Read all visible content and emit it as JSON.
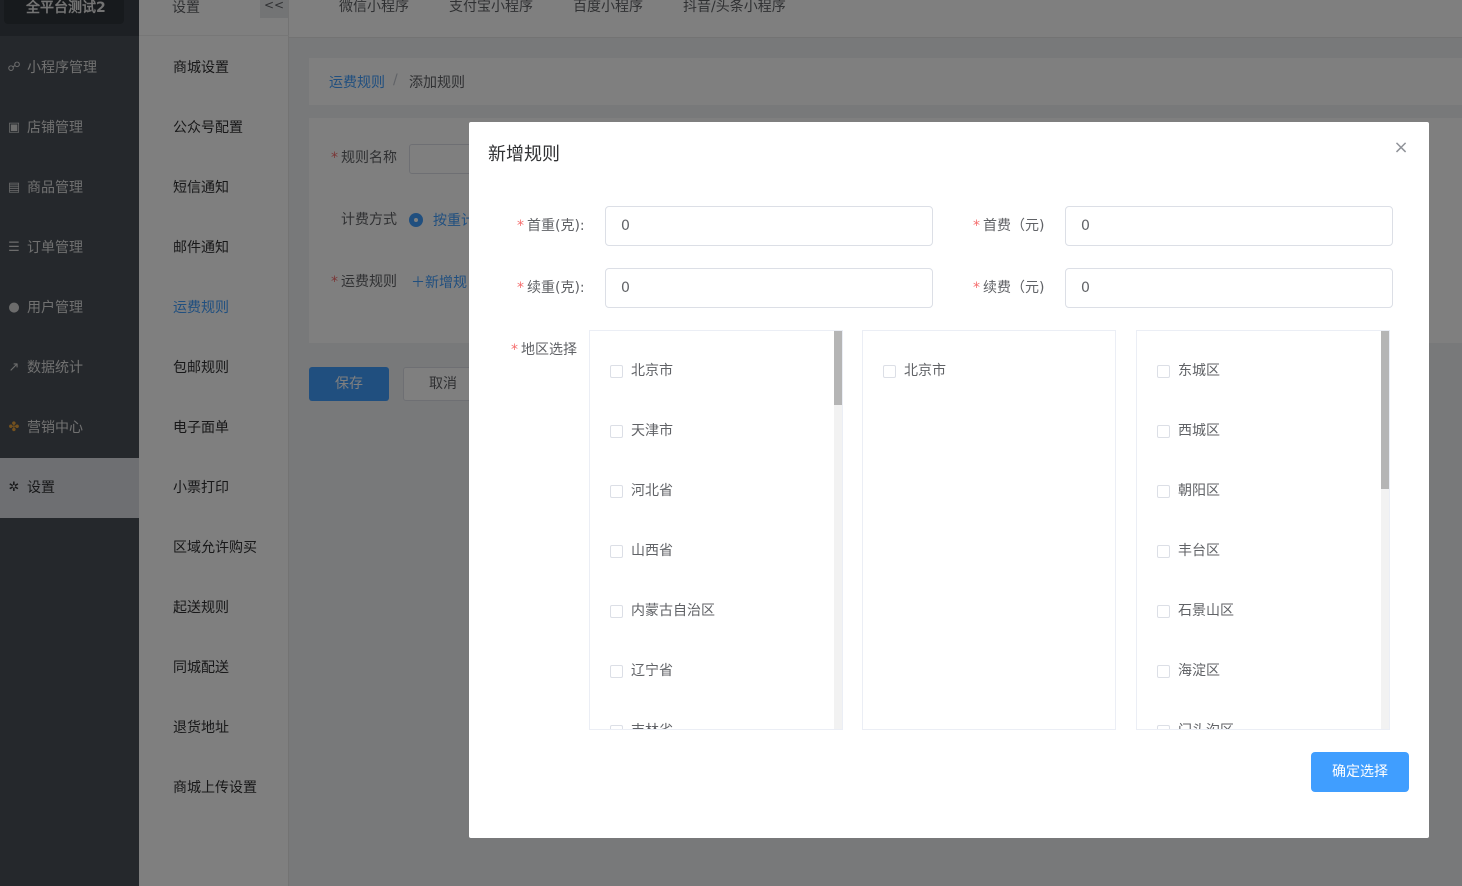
{
  "nav": {
    "brand": "全平台测试2",
    "items": [
      {
        "label": "小程序管理",
        "icon": "link-icon",
        "glyph": "☍"
      },
      {
        "label": "店铺管理",
        "icon": "store-icon",
        "glyph": "▣"
      },
      {
        "label": "商品管理",
        "icon": "goods-icon",
        "glyph": "▤"
      },
      {
        "label": "订单管理",
        "icon": "order-icon",
        "glyph": "☰"
      },
      {
        "label": "用户管理",
        "icon": "user-icon",
        "glyph": "●"
      },
      {
        "label": "数据统计",
        "icon": "chart-icon",
        "glyph": "↗"
      },
      {
        "label": "营销中心",
        "icon": "marketing-icon",
        "glyph": "✤"
      },
      {
        "label": "设置",
        "icon": "gear-icon",
        "glyph": "✲"
      }
    ]
  },
  "submenu": {
    "title": "设置",
    "collapse": "<<",
    "items": [
      "商城设置",
      "公众号配置",
      "短信通知",
      "邮件通知",
      "运费规则",
      "包邮规则",
      "电子面单",
      "小票打印",
      "区域允许购买",
      "起送规则",
      "同城配送",
      "退货地址",
      "商城上传设置"
    ],
    "active": "运费规则"
  },
  "tabs": [
    "微信小程序",
    "支付宝小程序",
    "百度小程序",
    "抖音/头条小程序"
  ],
  "breadcrumb": {
    "parent": "运费规则",
    "sep": "/",
    "current": "添加规则"
  },
  "form": {
    "name_label": "规则名称",
    "billing_label": "计费方式",
    "billing_option": "按重计",
    "fee_label": "运费规则",
    "add_rule": "＋新增规",
    "save": "保存",
    "cancel": "取消"
  },
  "dialog": {
    "title": "新增规则",
    "close": "×",
    "first_weight_label": "首重(克):",
    "first_weight_value": "0",
    "first_fee_label": "首费（元)",
    "first_fee_value": "0",
    "extra_weight_label": "续重(克):",
    "extra_weight_value": "0",
    "extra_fee_label": "续费（元)",
    "extra_fee_value": "0",
    "region_label": "地区选择",
    "provinces": [
      "北京市",
      "天津市",
      "河北省",
      "山西省",
      "内蒙古自治区",
      "辽宁省",
      "吉林省"
    ],
    "cities": [
      "北京市"
    ],
    "districts": [
      "东城区",
      "西城区",
      "朝阳区",
      "丰台区",
      "石景山区",
      "海淀区",
      "门头沟区"
    ],
    "confirm": "确定选择"
  },
  "colors": {
    "primary": "#409eff",
    "nav_bg": "#4a5159",
    "required": "#f56c6c"
  }
}
